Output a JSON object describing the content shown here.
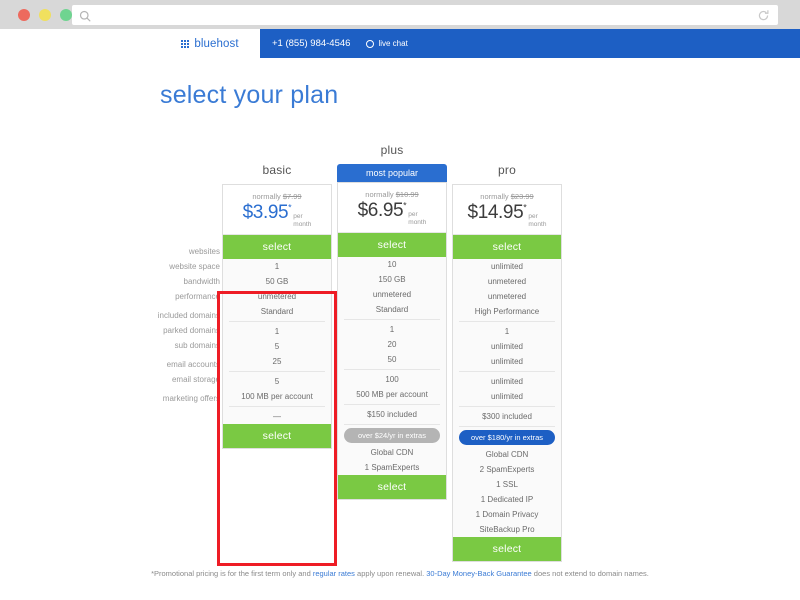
{
  "browser": {
    "url_value": "",
    "url_placeholder": "",
    "search_icon": "search-icon",
    "reload_icon": "reload-icon"
  },
  "header": {
    "logo_text": "bluehost",
    "phone": "+1 (855) 984-4546",
    "live_chat": "live chat"
  },
  "page": {
    "title": "select your plan"
  },
  "feature_labels": [
    "websites",
    "website space",
    "bandwidth",
    "performance",
    "included domains",
    "parked domains",
    "sub domains",
    "email accounts",
    "email storage",
    "marketing offers"
  ],
  "plans": [
    {
      "name": "basic",
      "badge": "",
      "normally_prefix": "normally ",
      "normally_price": "$7.99",
      "price": "$3.95",
      "star": "*",
      "per": "per",
      "month": "month",
      "select_top": "select",
      "select_bottom": "select",
      "features_group1": [
        "1",
        "50 GB",
        "unmetered",
        "Standard"
      ],
      "features_group2": [
        "1",
        "5",
        "25"
      ],
      "features_group3": [
        "5",
        "100 MB per account"
      ],
      "features_group4": [
        "—"
      ],
      "extras_pill": "",
      "extras": []
    },
    {
      "name": "plus",
      "badge": "most popular",
      "normally_prefix": "normally ",
      "normally_price": "$10.99",
      "price": "$6.95",
      "star": "*",
      "per": "per",
      "month": "month",
      "select_top": "select",
      "select_bottom": "select",
      "features_group1": [
        "10",
        "150 GB",
        "unmetered",
        "Standard"
      ],
      "features_group2": [
        "1",
        "20",
        "50"
      ],
      "features_group3": [
        "100",
        "500 MB per account"
      ],
      "features_group4": [
        "$150 included"
      ],
      "extras_pill": "over $24/yr in extras",
      "extras": [
        "Global CDN",
        "1 SpamExperts"
      ]
    },
    {
      "name": "pro",
      "badge": "",
      "normally_prefix": "normally ",
      "normally_price": "$23.99",
      "price": "$14.95",
      "star": "*",
      "per": "per",
      "month": "month",
      "select_top": "select",
      "select_bottom": "select",
      "features_group1": [
        "unlimited",
        "unmetered",
        "unmetered",
        "High Performance"
      ],
      "features_group2": [
        "1",
        "unlimited",
        "unlimited"
      ],
      "features_group3": [
        "unlimited",
        "unlimited"
      ],
      "features_group4": [
        "$300 included"
      ],
      "extras_pill": "over $180/yr in extras",
      "extras": [
        "Global CDN",
        "2 SpamExperts",
        "1 SSL",
        "1 Dedicated IP",
        "1 Domain Privacy",
        "SiteBackup Pro"
      ]
    }
  ],
  "footer": {
    "part1": "*Promotional pricing is for the first term only and ",
    "link1": "regular rates",
    "part2": " apply upon renewal. ",
    "link2": "30-Day Money-Back Guarantee",
    "part3": " does not extend to domain names."
  },
  "colors": {
    "brand_blue": "#1d5fc4",
    "title_blue": "#3a7bd5",
    "select_green": "#7ac943",
    "highlight_red": "#ee1c25",
    "pill_gray": "#b4b4b4"
  }
}
